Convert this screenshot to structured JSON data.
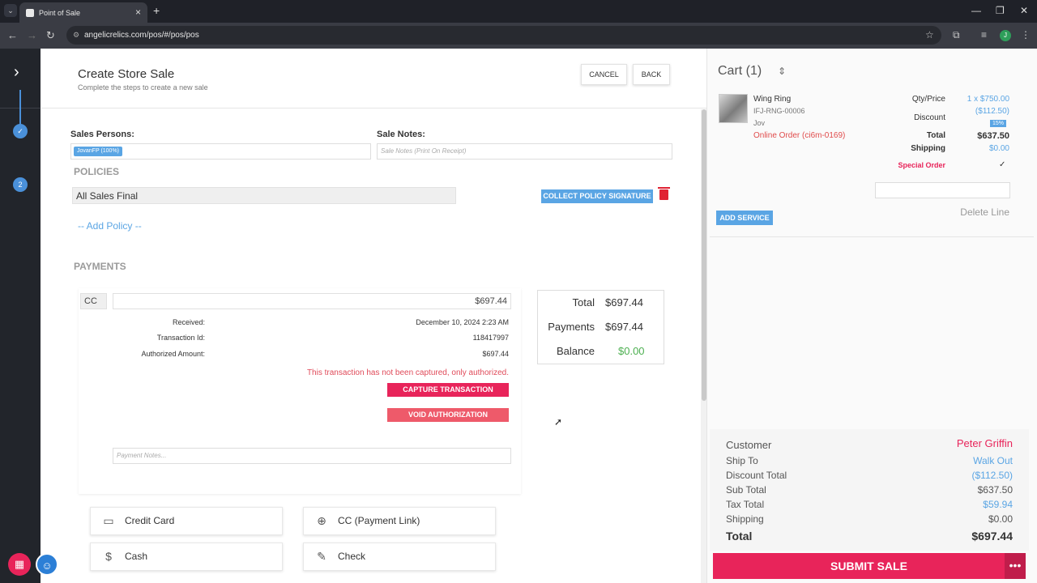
{
  "browser": {
    "tab_title": "Point of Sale",
    "url": "angelicrelics.com/pos/#/pos/pos",
    "profile_initial": "J"
  },
  "rail": {
    "step2_label": "2"
  },
  "header": {
    "title": "Create Store Sale",
    "subtitle": "Complete the steps to create a new sale",
    "cancel_label": "CANCEL",
    "back_label": "BACK"
  },
  "sale": {
    "sales_persons_label": "Sales Persons:",
    "sales_person_chip": "JovanFP (100%)",
    "sale_notes_label": "Sale Notes:",
    "sale_notes_placeholder": "Sale Notes (Print On Receipt)"
  },
  "policies": {
    "section_label": "POLICIES",
    "policy_name": "All Sales Final",
    "collect_label": "COLLECT POLICY SIGNATURE",
    "add_policy_label": "-- Add Policy --"
  },
  "payments": {
    "section_label": "PAYMENTS",
    "method": "CC",
    "amount": "$697.44",
    "received_label": "Received:",
    "received_value": "December 10, 2024 2:23 AM",
    "txn_label": "Transaction Id:",
    "txn_value": "118417997",
    "auth_label": "Authorized Amount:",
    "auth_value": "$697.44",
    "warning": "This transaction has not been captured, only authorized.",
    "capture_label": "CAPTURE TRANSACTION",
    "void_label": "VOID AUTHORIZATION",
    "notes_placeholder": "Payment Notes...",
    "methods": [
      "Credit Card",
      "CC (Payment Link)",
      "Cash",
      "Check"
    ]
  },
  "totals_box": {
    "total_label": "Total",
    "total_value": "$697.44",
    "payments_label": "Payments",
    "payments_value": "$697.44",
    "balance_label": "Balance",
    "balance_value": "$0.00"
  },
  "cart": {
    "title": "Cart (1)",
    "item": {
      "name": "Wing Ring",
      "sku": "IFJ-RNG-00006",
      "owner": "Jov",
      "order": "Online Order (ci6m-0169)",
      "qty_price_label": "Qty/Price",
      "qty_price_value": "1 x $750.00",
      "discount_label": "Discount",
      "discount_value": "($112.50)",
      "discount_pct": "15%",
      "total_label": "Total",
      "total_value": "$637.50",
      "shipping_label": "Shipping",
      "shipping_value": "$0.00",
      "special_order_label": "Special Order",
      "special_order_check": "✓"
    },
    "add_service_label": "ADD SERVICE",
    "delete_line_label": "Delete Line"
  },
  "summary": {
    "customer_label": "Customer",
    "customer_value": "Peter Griffin",
    "ship_to_label": "Ship To",
    "ship_to_value": "Walk Out",
    "discount_total_label": "Discount Total",
    "discount_total_value": "($112.50)",
    "sub_total_label": "Sub Total",
    "sub_total_value": "$637.50",
    "tax_total_label": "Tax Total",
    "tax_total_value": "$59.94",
    "shipping_label": "Shipping",
    "shipping_value": "$0.00",
    "total_label": "Total",
    "total_value": "$697.44",
    "submit_label": "SUBMIT SALE",
    "more_label": "•••"
  },
  "colors": {
    "accent_blue": "#5aa5e4",
    "accent_red": "#e8245a",
    "order_red": "#e04b4b",
    "balance_green": "#4caf50"
  }
}
